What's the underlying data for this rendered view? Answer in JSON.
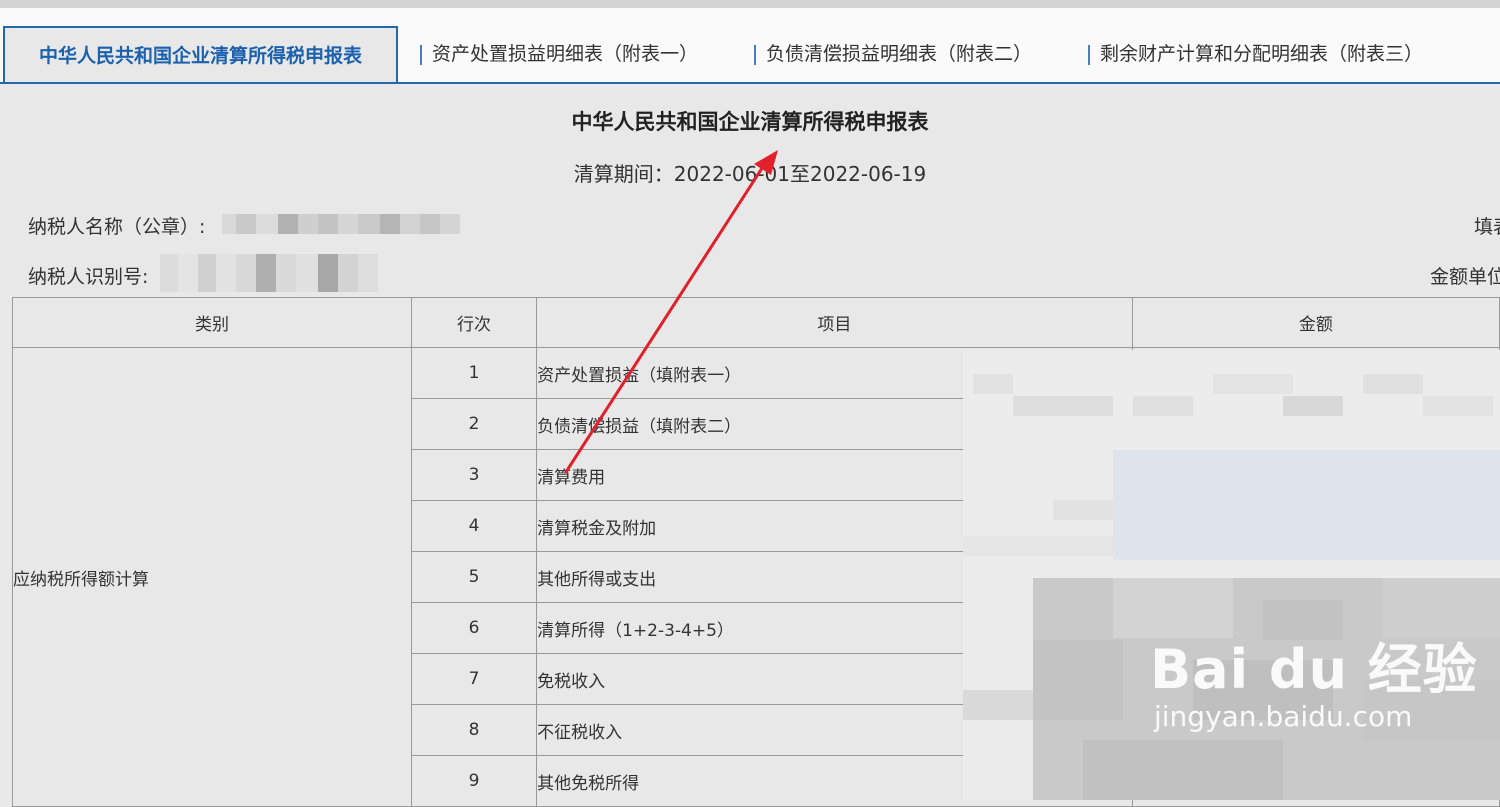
{
  "tabs": [
    {
      "label": "中华人民共和国企业清算所得税申报表",
      "active": true
    },
    {
      "label": "资产处置损益明细表（附表一）",
      "active": false
    },
    {
      "label": "负债清偿损益明细表（附表二）",
      "active": false
    },
    {
      "label": "剩余财产计算和分配明细表（附表三）",
      "active": false
    }
  ],
  "form": {
    "title": "中华人民共和国企业清算所得税申报表",
    "period_label": "清算期间：",
    "period_value": "2022-06-01至2022-06-19",
    "taxpayer_name_label": "纳税人名称（公章）:",
    "taxpayer_id_label": "纳税人识别号:",
    "fill_date_label_partial": "填表",
    "amount_unit_label_partial": "金额单位"
  },
  "table": {
    "headers": [
      "类别",
      "行次",
      "项目",
      "金额"
    ],
    "category": "应纳税所得额计算",
    "rows": [
      {
        "no": "1",
        "item": "资产处置损益（填附表一）"
      },
      {
        "no": "2",
        "item": "负债清偿损益（填附表二）"
      },
      {
        "no": "3",
        "item": "清算费用"
      },
      {
        "no": "4",
        "item": "清算税金及附加"
      },
      {
        "no": "5",
        "item": "其他所得或支出"
      },
      {
        "no": "6",
        "item": "清算所得（1+2-3-4+5）"
      },
      {
        "no": "7",
        "item": "免税收入"
      },
      {
        "no": "8",
        "item": "不征税收入"
      },
      {
        "no": "9",
        "item": "其他免税所得"
      }
    ]
  },
  "watermark": {
    "logo_text": "Bai du 经验",
    "url": "jingyan.baidu.com"
  },
  "colors": {
    "accent": "#2468b0",
    "arrow": "#e0202a"
  }
}
